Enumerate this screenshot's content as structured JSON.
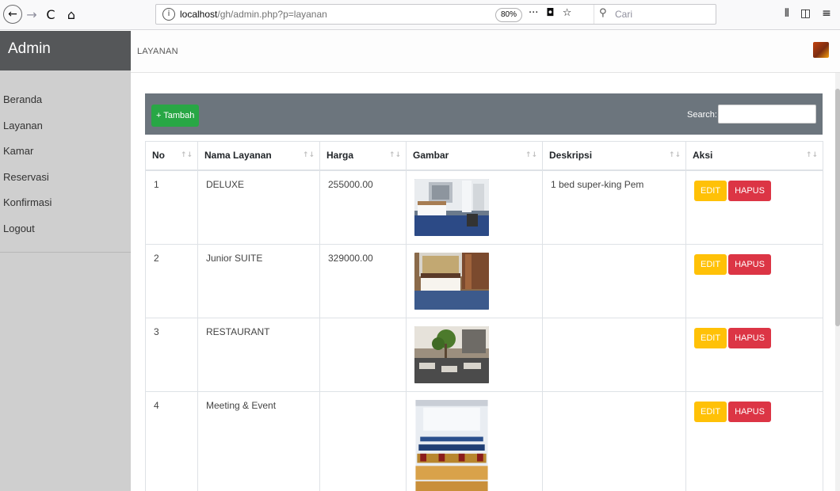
{
  "browser": {
    "url_prefix": "localhost",
    "url_path": "/gh/admin.php?p=layanan",
    "zoom": "80%",
    "search_placeholder": "Cari",
    "info_glyph": "i",
    "back_glyph": "←",
    "forward_glyph": "→",
    "reload_glyph": "C",
    "home_glyph": "⌂",
    "more_glyph": "···",
    "pocket_glyph": "◘",
    "bookmark_glyph": "☆",
    "search_glyph": "⚲",
    "library_glyph": "⫴",
    "sidebar_glyph": "◫",
    "menu_glyph": "≡"
  },
  "sidebar": {
    "brand": "Admin",
    "items": [
      {
        "label": "Beranda"
      },
      {
        "label": "Layanan"
      },
      {
        "label": "Kamar"
      },
      {
        "label": "Reservasi"
      },
      {
        "label": "Konfirmasi"
      },
      {
        "label": "Logout"
      }
    ]
  },
  "topbar": {
    "title": "LAYANAN"
  },
  "toolbar": {
    "add_label": "+ Tambah",
    "search_label": "Search:"
  },
  "table": {
    "sort_glyph": "↑↓",
    "headers": [
      "No",
      "Nama Layanan",
      "Harga",
      "Gambar",
      "Deskripsi",
      "Aksi"
    ],
    "rows": [
      {
        "no": "1",
        "name": "DELUXE",
        "price": "255000.00",
        "desc": "1 bed super-king Pem",
        "edit": "EDIT",
        "delete": "HAPUS"
      },
      {
        "no": "2",
        "name": "Junior SUITE",
        "price": "329000.00",
        "desc": "",
        "edit": "EDIT",
        "delete": "HAPUS"
      },
      {
        "no": "3",
        "name": "RESTAURANT",
        "price": "",
        "desc": "",
        "edit": "EDIT",
        "delete": "HAPUS"
      },
      {
        "no": "4",
        "name": "Meeting & Event",
        "price": "",
        "desc": "",
        "edit": "EDIT",
        "delete": "HAPUS"
      }
    ]
  },
  "colors": {
    "brand_bg": "#555759",
    "sidebar_bg": "#cfcfcf",
    "card_header": "#6c757d",
    "add_button": "#28a745",
    "edit_button": "#ffc107",
    "delete_button": "#dc3545"
  }
}
